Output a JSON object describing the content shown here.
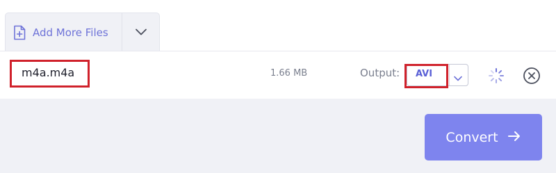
{
  "toolbar": {
    "add_files_label": "Add More Files"
  },
  "file": {
    "name": "m4a.m4a",
    "size": "1.66 MB",
    "output_label": "Output:",
    "output_format": "AVI"
  },
  "actions": {
    "convert_label": "Convert"
  },
  "colors": {
    "accent": "#7e84ee",
    "accent_text": "#6e73d8",
    "highlight": "#d0212b",
    "panel_bg": "#f0f1f6"
  },
  "icons": {
    "add_file": "file-plus-icon",
    "dropdown": "chevron-down-icon",
    "loading": "spinner-icon",
    "remove": "close-circle-icon",
    "convert": "arrow-right-icon"
  }
}
